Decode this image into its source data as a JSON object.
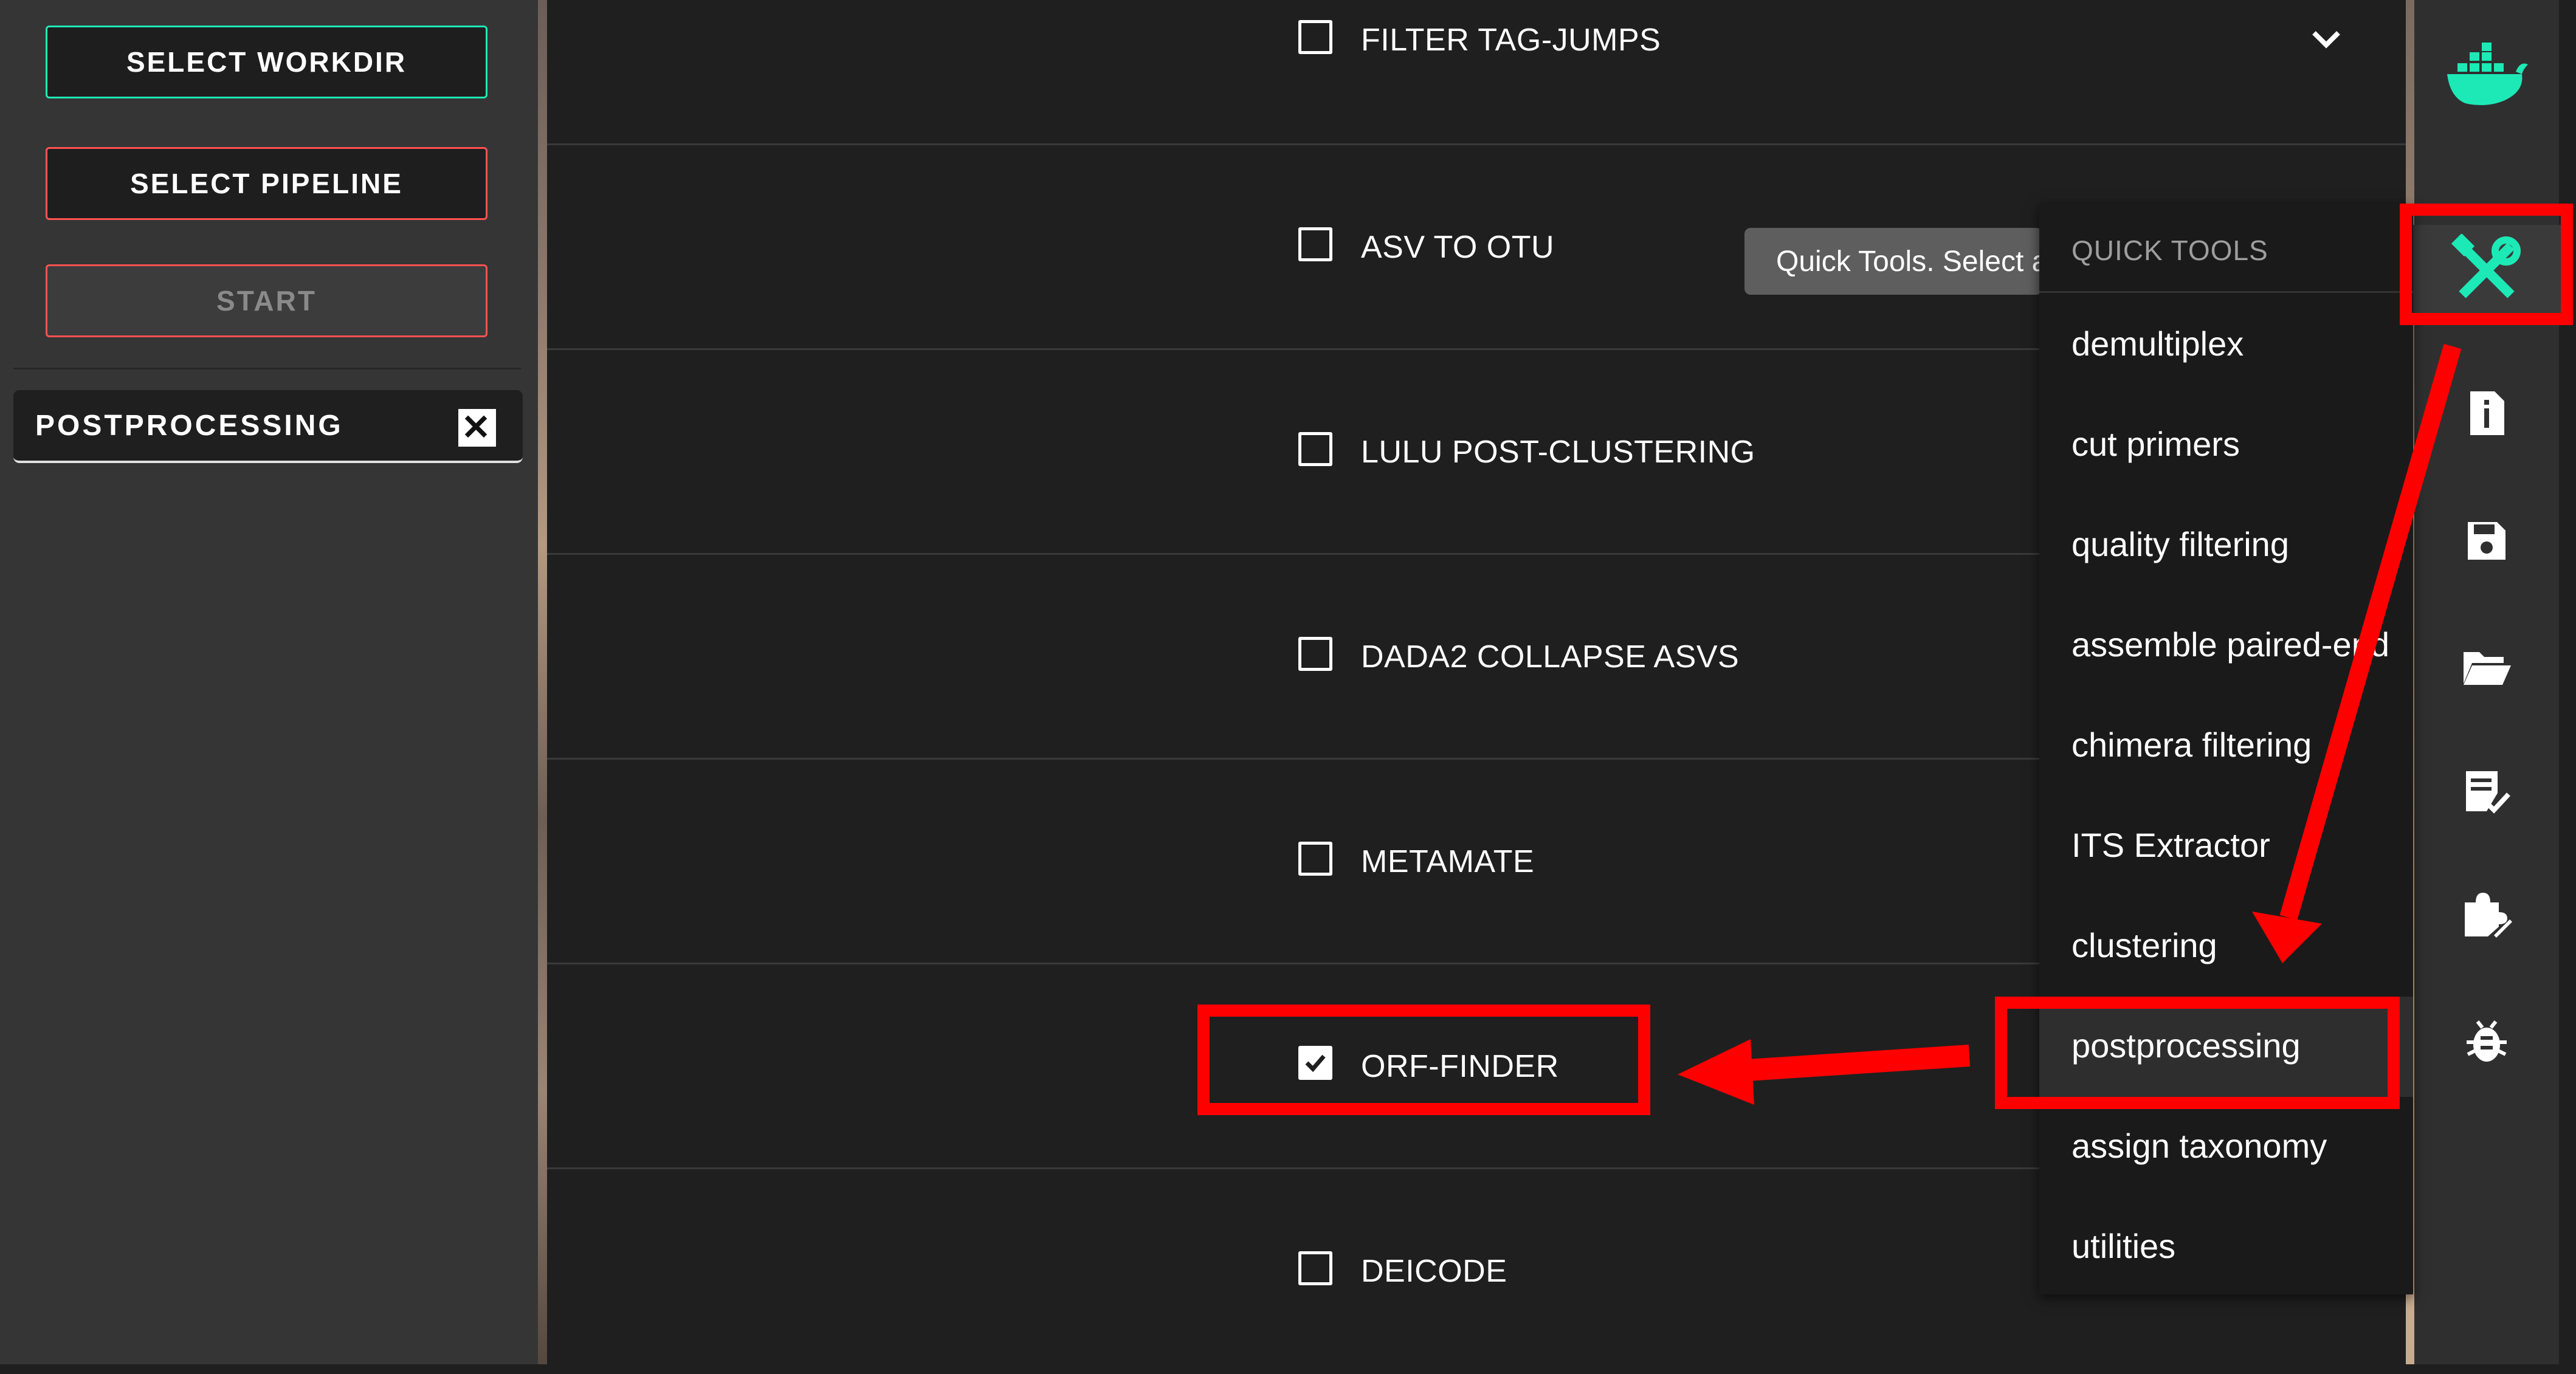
{
  "left_panel": {
    "select_workdir": "SELECT WORKDIR",
    "select_pipeline": "SELECT PIPELINE",
    "start": "START",
    "active_step": "POSTPROCESSING"
  },
  "steps": [
    {
      "label": "FILTER TAG-JUMPS",
      "checked": false
    },
    {
      "label": "ASV TO OTU",
      "checked": false
    },
    {
      "label": "LULU POST-CLUSTERING",
      "checked": false
    },
    {
      "label": "DADA2 COLLAPSE ASVS",
      "checked": false
    },
    {
      "label": "METAMATE",
      "checked": false
    },
    {
      "label": "ORF-FINDER",
      "checked": true
    },
    {
      "label": "DEICODE",
      "checked": false
    }
  ],
  "tooltip": "Quick Tools. Select a",
  "quick_tools": {
    "header": "QUICK TOOLS",
    "items": [
      "demultiplex",
      "cut primers",
      "quality filtering",
      "assemble paired-end",
      "chimera filtering",
      "ITS Extractor",
      "clustering",
      "postprocessing",
      "assign taxonomy",
      "utilities"
    ],
    "highlighted": "postprocessing"
  },
  "sidebar_icons": [
    "docker-icon",
    "quick-tools-icon",
    "info-doc-icon",
    "save-icon",
    "folder-open-icon",
    "checklist-icon",
    "puzzle-edit-icon",
    "bug-icon"
  ],
  "colors": {
    "accent": "#1de9b6",
    "annotation": "#ff0000",
    "start_border": "#ff5252"
  }
}
